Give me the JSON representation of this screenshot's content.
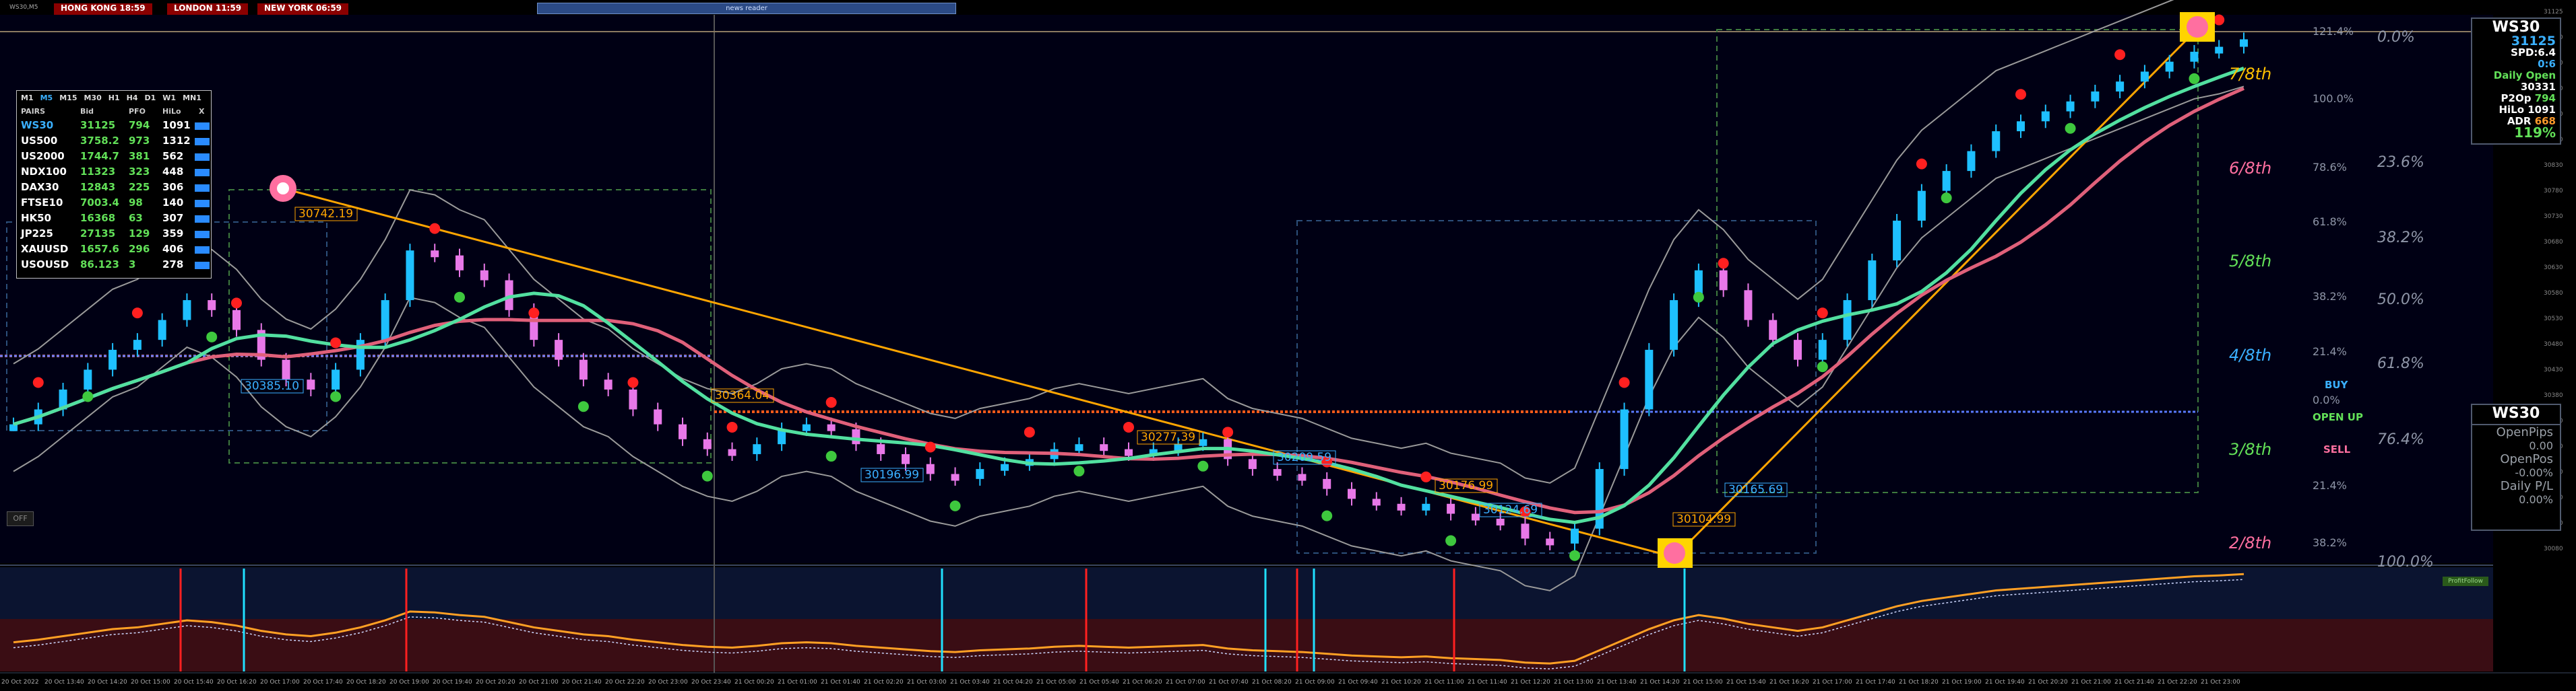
{
  "window": {
    "symbol_label": "WS30,M5",
    "news_title": "news reader",
    "clocks": [
      "HONG KONG 18:59",
      "LONDON 11:59",
      "NEW YORK 06:59"
    ],
    "off_button": "OFF",
    "indicator_tag": "ProfitFollow"
  },
  "pairs_panel": {
    "timeframes": [
      "M1",
      "M5",
      "M15",
      "M30",
      "H1",
      "H4",
      "D1",
      "W1",
      "MN1"
    ],
    "headers": [
      "PAIRS",
      "Bid",
      "PFO",
      "HiLo",
      "X"
    ],
    "rows": [
      {
        "pair": "WS30",
        "bid": "31125",
        "pfo": "794",
        "hilo": "1091"
      },
      {
        "pair": "US500",
        "bid": "3758.2",
        "pfo": "973",
        "hilo": "1312"
      },
      {
        "pair": "US2000",
        "bid": "1744.7",
        "pfo": "381",
        "hilo": "562"
      },
      {
        "pair": "NDX100",
        "bid": "11323",
        "pfo": "323",
        "hilo": "448"
      },
      {
        "pair": "DAX30",
        "bid": "12843",
        "pfo": "225",
        "hilo": "306"
      },
      {
        "pair": "FTSE10",
        "bid": "7003.4",
        "pfo": "98",
        "hilo": "140"
      },
      {
        "pair": "HK50",
        "bid": "16368",
        "pfo": "63",
        "hilo": "307"
      },
      {
        "pair": "JP225",
        "bid": "27135",
        "pfo": "129",
        "hilo": "359"
      },
      {
        "pair": "XAUUSD",
        "bid": "1657.6",
        "pfo": "296",
        "hilo": "406"
      },
      {
        "pair": "USOUSD",
        "bid": "86.123",
        "pfo": "3",
        "hilo": "278"
      }
    ]
  },
  "info_panel": {
    "title": "WS30",
    "price": "31125",
    "spd": "SPD:6.4",
    "ratio": "0:6",
    "daily_open_label": "Daily Open",
    "daily_open": "30331",
    "p2op": "P2Op",
    "p2op_val": "794",
    "hilo": "HiLo",
    "hilo_val": "1091",
    "adr": "ADR",
    "adr_val": "668",
    "pct": "119%"
  },
  "pos_panel": {
    "title": "WS30",
    "open_pips_label": "OpenPips",
    "open_pips": "0.00",
    "open_pos_label": "OpenPos",
    "open_pos": "-0.00%",
    "daily_pl_label": "Daily P/L",
    "daily_pl": "0.00%"
  },
  "octaves": {
    "labels": [
      "7/8th",
      "6/8th",
      "5/8th",
      "4/8th",
      "3/8th",
      "2/8th"
    ],
    "colors": [
      "#ffc000",
      "#ff6fa0",
      "#62e058",
      "#3ab0ff",
      "#62e058",
      "#ff6fa0"
    ]
  },
  "fib_left": [
    "121.4%",
    "100.0%",
    "78.6%",
    "61.8%",
    "38.2%",
    "21.4%",
    "0.0%",
    "21.4%",
    "38.2%"
  ],
  "fib_right": [
    "0.0%",
    "23.6%",
    "38.2%",
    "50.0%",
    "61.8%",
    "76.4%",
    "100.0%"
  ],
  "signals": {
    "buy": "BUY",
    "open": "OPEN UP",
    "sell": "SELL"
  },
  "price_labels": [
    {
      "text": "30742.19"
    },
    {
      "text": "30385.10"
    },
    {
      "text": "30364.04"
    },
    {
      "text": "30196.99"
    },
    {
      "text": "30277.39"
    },
    {
      "text": "30209.59"
    },
    {
      "text": "30176.99"
    },
    {
      "text": "30124.69"
    },
    {
      "text": "30104.99"
    },
    {
      "text": "30165.69"
    }
  ],
  "x_axis_labels": [
    "20 Oct 2022",
    "20 Oct 13:40",
    "20 Oct 14:20",
    "20 Oct 15:00",
    "20 Oct 15:40",
    "20 Oct 16:20",
    "20 Oct 17:00",
    "20 Oct 17:40",
    "20 Oct 18:20",
    "20 Oct 19:00",
    "20 Oct 19:40",
    "20 Oct 20:20",
    "20 Oct 21:00",
    "20 Oct 21:40",
    "20 Oct 22:20",
    "20 Oct 23:00",
    "20 Oct 23:40",
    "21 Oct 00:20",
    "21 Oct 01:00",
    "21 Oct 01:40",
    "21 Oct 02:20",
    "21 Oct 03:00",
    "21 Oct 03:40",
    "21 Oct 04:20",
    "21 Oct 05:00",
    "21 Oct 05:40",
    "21 Oct 06:20",
    "21 Oct 07:00",
    "21 Oct 07:40",
    "21 Oct 08:20",
    "21 Oct 09:00",
    "21 Oct 09:40",
    "21 Oct 10:20",
    "21 Oct 11:00",
    "21 Oct 11:40",
    "21 Oct 12:20",
    "21 Oct 13:00",
    "21 Oct 13:40",
    "21 Oct 14:20",
    "21 Oct 15:00",
    "21 Oct 15:40",
    "21 Oct 16:20",
    "21 Oct 17:00",
    "21 Oct 17:40",
    "21 Oct 18:20",
    "21 Oct 19:00",
    "21 Oct 19:40",
    "21 Oct 20:20",
    "21 Oct 21:00",
    "21 Oct 21:40",
    "21 Oct 22:20",
    "21 Oct 23:00"
  ],
  "y_axis_labels": [
    "31125",
    "31080",
    "31030",
    "30980",
    "30930",
    "30880",
    "30830",
    "30780",
    "30730",
    "30680",
    "30630",
    "30580",
    "30530",
    "30480",
    "30430",
    "30380",
    "30330",
    "30280",
    "30230",
    "30180",
    "30130",
    "30080"
  ],
  "chart_data": {
    "type": "line",
    "title": "",
    "xlabel": "",
    "ylabel": "",
    "ylim": [
      30080,
      31150
    ],
    "series": [
      {
        "values": [
          30350,
          30380,
          30420,
          30460,
          30500,
          30520,
          30560,
          30600,
          30580,
          30540,
          30480,
          30440,
          30420,
          30460,
          30520,
          30600,
          30700,
          30690,
          30660,
          30640,
          30580,
          30520,
          30480,
          30440,
          30420,
          30380,
          30350,
          30320,
          30300,
          30290,
          30310,
          30340,
          30350,
          30340,
          30310,
          30290,
          30270,
          30250,
          30240,
          30260,
          30270,
          30280,
          30300,
          30310,
          30300,
          30290,
          30300,
          30310,
          30320,
          30280,
          30260,
          30250,
          30240,
          30220,
          30200,
          30190,
          30180,
          30190,
          30170,
          30160,
          30150,
          30120,
          30110,
          30140,
          30260,
          30380,
          30500,
          30600,
          30660,
          30620,
          30560,
          30520,
          30480,
          30520,
          30600,
          30680,
          30760,
          30820,
          30860,
          30900,
          30940,
          30960,
          30980,
          31000,
          31020,
          31040,
          31060,
          31080,
          31100,
          31110,
          31125
        ]
      }
    ]
  }
}
